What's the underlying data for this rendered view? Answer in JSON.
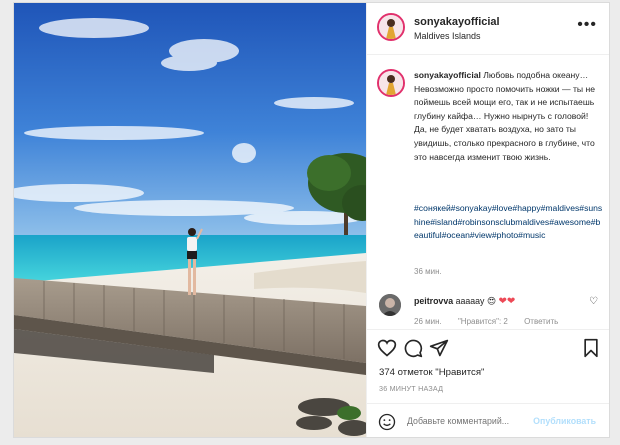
{
  "post": {
    "username": "sonyakayofficial",
    "location": "Maldives Islands",
    "more_icon": "more-horizontal-icon"
  },
  "caption": {
    "username": "sonyakayofficial",
    "text": "Любовь подобна океану… Невозможно просто помочить ножки — ты не поймешь всей мощи его, так и не испытаешь глубину кайфа… Нужно нырнуть с головой! Да, не будет хватать воздуха, но зато ты увидишь, столько прекрасного в глубине, что это навсегда изменит твою жизнь.",
    "hashtags": "#сонякей#sonyakay#love#happy#maldives#sunshine#island#robinsonsclubmaldives#awesome#beautiful#ocean#view#photo#music",
    "time": "36 мин."
  },
  "comment": {
    "username": "peitrovva",
    "text": "aaaaay 😍",
    "hearts": "❤❤",
    "time": "26 мин.",
    "likes": "\"Нравится\": 2",
    "reply": "Ответить"
  },
  "actions": {
    "likes_text": "374 отметок \"Нравится\"",
    "timestamp": "36 МИНУТ НАЗАД"
  },
  "add_comment": {
    "placeholder": "Добавьте комментарий...",
    "publish": "Опубликовать"
  },
  "colors": {
    "accent": "#e1306c",
    "link": "#00376b",
    "muted": "#8e8e8e",
    "publish_disabled": "#b2dffc",
    "heart": "#ed4956"
  }
}
